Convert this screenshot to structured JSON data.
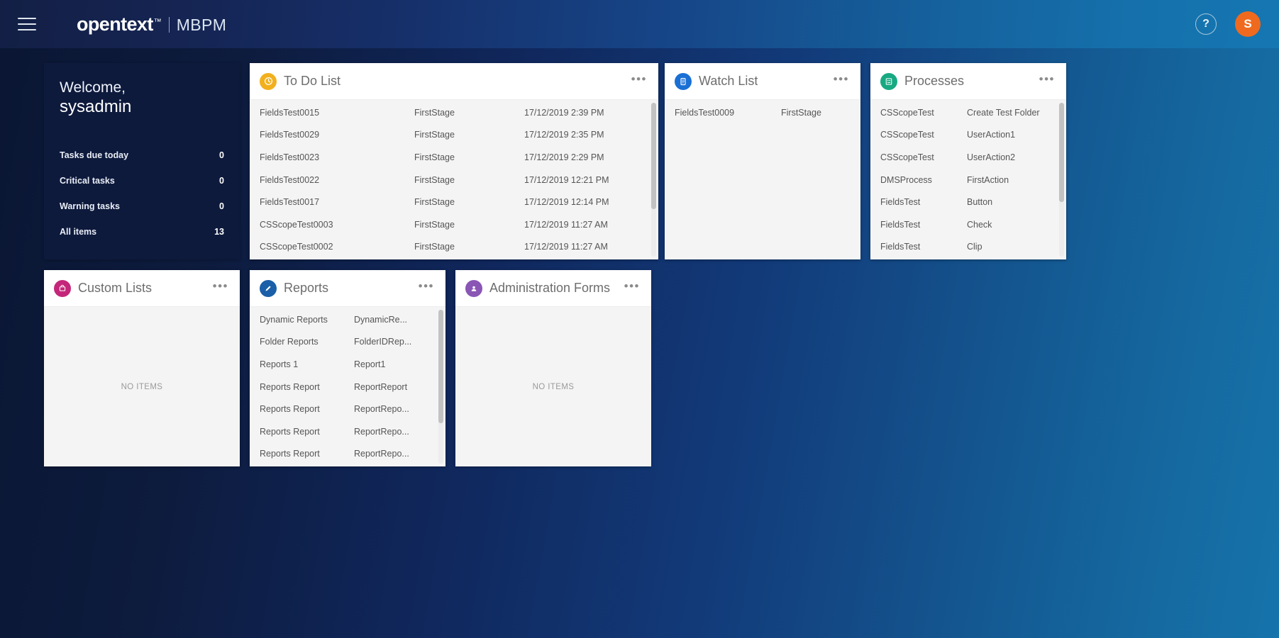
{
  "header": {
    "menu_icon": "hamburger-icon",
    "brand": "opentext",
    "brand_tm": "™",
    "product": "MBPM",
    "help_label": "?",
    "avatar_initial": "S",
    "accent_orange": "#ef6a1e"
  },
  "welcome": {
    "greeting": "Welcome,",
    "username": "sysadmin",
    "stats": [
      {
        "label": "Tasks due today",
        "value": "0"
      },
      {
        "label": "Critical tasks",
        "value": "0"
      },
      {
        "label": "Warning tasks",
        "value": "0"
      },
      {
        "label": "All items",
        "value": "13"
      }
    ]
  },
  "tiles": {
    "todo": {
      "title": "To Do List",
      "icon": "todo-icon",
      "icon_color": "#f2b01e",
      "menu": "•••",
      "rows": [
        {
          "name": "FieldsTest0015",
          "stage": "FirstStage",
          "date": "17/12/2019 2:39 PM"
        },
        {
          "name": "FieldsTest0029",
          "stage": "FirstStage",
          "date": "17/12/2019 2:35 PM"
        },
        {
          "name": "FieldsTest0023",
          "stage": "FirstStage",
          "date": "17/12/2019 2:29 PM"
        },
        {
          "name": "FieldsTest0022",
          "stage": "FirstStage",
          "date": "17/12/2019 12:21 PM"
        },
        {
          "name": "FieldsTest0017",
          "stage": "FirstStage",
          "date": "17/12/2019 12:14 PM"
        },
        {
          "name": "CSScopeTest0003",
          "stage": "FirstStage",
          "date": "17/12/2019 11:27 AM"
        },
        {
          "name": "CSScopeTest0002",
          "stage": "FirstStage",
          "date": "17/12/2019 11:27 AM"
        }
      ]
    },
    "watch": {
      "title": "Watch List",
      "icon": "watch-icon",
      "icon_color": "#1a6fd4",
      "menu": "•••",
      "rows": [
        {
          "name": "FieldsTest0009",
          "stage": "FirstStage"
        }
      ]
    },
    "processes": {
      "title": "Processes",
      "icon": "processes-icon",
      "icon_color": "#17a982",
      "menu": "•••",
      "rows": [
        {
          "name": "CSScopeTest",
          "action": "Create Test Folder"
        },
        {
          "name": "CSScopeTest",
          "action": "UserAction1"
        },
        {
          "name": "CSScopeTest",
          "action": "UserAction2"
        },
        {
          "name": "DMSProcess",
          "action": "FirstAction"
        },
        {
          "name": "FieldsTest",
          "action": "Button"
        },
        {
          "name": "FieldsTest",
          "action": "Check"
        },
        {
          "name": "FieldsTest",
          "action": "Clip"
        }
      ]
    },
    "custom_lists": {
      "title": "Custom Lists",
      "icon": "custom-lists-icon",
      "icon_color": "#c4277a",
      "menu": "•••",
      "empty_text": "NO ITEMS"
    },
    "reports": {
      "title": "Reports",
      "icon": "reports-icon",
      "icon_color": "#1a5fa8",
      "menu": "•••",
      "rows": [
        {
          "name": "Dynamic Reports",
          "value": "DynamicRe..."
        },
        {
          "name": "Folder Reports",
          "value": "FolderIDRep..."
        },
        {
          "name": "Reports 1",
          "value": "Report1"
        },
        {
          "name": "Reports Report",
          "value": "ReportReport"
        },
        {
          "name": "Reports Report",
          "value": "ReportRepo..."
        },
        {
          "name": "Reports Report",
          "value": "ReportRepo..."
        },
        {
          "name": "Reports Report",
          "value": "ReportRepo..."
        }
      ]
    },
    "admin_forms": {
      "title": "Administration Forms",
      "icon": "admin-forms-icon",
      "icon_color": "#8a56b5",
      "menu": "•••",
      "empty_text": "NO ITEMS"
    }
  }
}
